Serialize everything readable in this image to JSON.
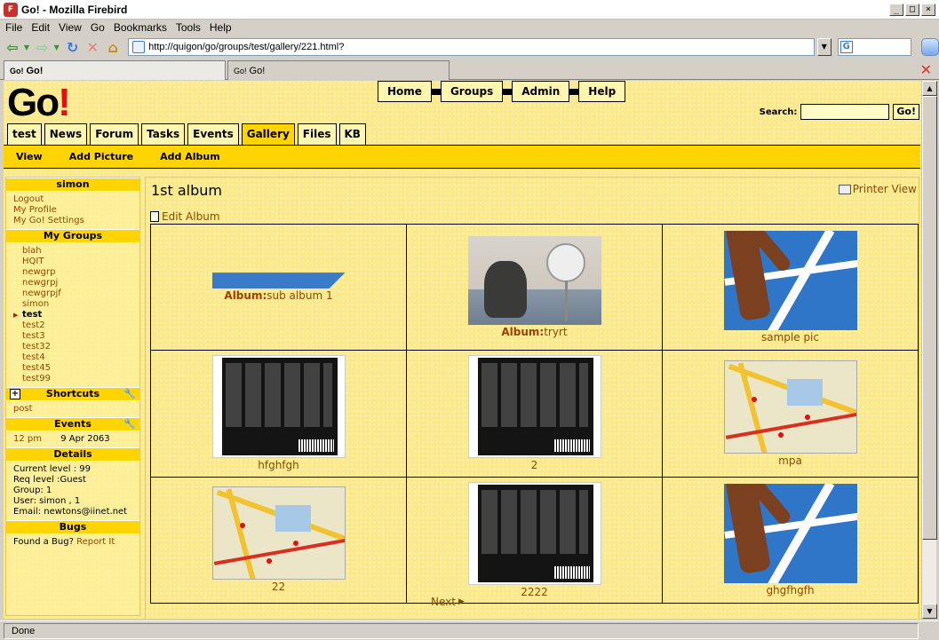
{
  "window": {
    "title": "Go! - Mozilla Firebird",
    "app_icon": "firebird-icon",
    "controls": [
      "minimize",
      "maximize",
      "close"
    ]
  },
  "menu": [
    "File",
    "Edit",
    "View",
    "Go",
    "Bookmarks",
    "Tools",
    "Help"
  ],
  "navigation": {
    "url": "http://quigon/go/groups/test/gallery/221.html?",
    "search_value": "",
    "search_engine_icon": "google-icon"
  },
  "tabs": [
    {
      "favicon": "Go!",
      "label": "Go!",
      "active": true
    },
    {
      "favicon": "Go!",
      "label": "Go!",
      "active": false
    }
  ],
  "status": "Done",
  "site": {
    "logo_text": "Go",
    "logo_bang": "!",
    "top_nav": [
      "Home",
      "Groups",
      "Admin",
      "Help"
    ],
    "search_label": "Search:",
    "search_value": "",
    "search_button": "Go!",
    "main_tabs": [
      {
        "label": "test",
        "active": false
      },
      {
        "label": "News",
        "active": false
      },
      {
        "label": "Forum",
        "active": false
      },
      {
        "label": "Tasks",
        "active": false
      },
      {
        "label": "Events",
        "active": false
      },
      {
        "label": "Gallery",
        "active": true
      },
      {
        "label": "Files",
        "active": false
      },
      {
        "label": "KB",
        "active": false
      }
    ],
    "sub_nav": [
      "View",
      "Add Picture",
      "Add Album"
    ]
  },
  "sidebar": {
    "user_header": "simon",
    "user_links": [
      "Logout",
      "My Profile",
      "My Go! Settings"
    ],
    "groups_header": "My Groups",
    "groups": [
      {
        "name": "blah",
        "current": false
      },
      {
        "name": "HQIT",
        "current": false
      },
      {
        "name": "newgrp",
        "current": false
      },
      {
        "name": "newgrpj",
        "current": false
      },
      {
        "name": "newgrpjf",
        "current": false
      },
      {
        "name": "simon",
        "current": false
      },
      {
        "name": "test",
        "current": true
      },
      {
        "name": "test2",
        "current": false
      },
      {
        "name": "test3",
        "current": false
      },
      {
        "name": "test32",
        "current": false
      },
      {
        "name": "test4",
        "current": false
      },
      {
        "name": "test45",
        "current": false
      },
      {
        "name": "test99",
        "current": false
      }
    ],
    "shortcuts_header": "Shortcuts",
    "shortcuts": [
      "post"
    ],
    "events_header": "Events",
    "event_time": "12 pm",
    "event_date": "9 Apr 2063",
    "details_header": "Details",
    "details": {
      "current_level": "Current level : 99",
      "req_level": "Req level :Guest",
      "group": "Group: 1",
      "user": "User: simon , 1",
      "email": "Email: newtons@iinet.net"
    },
    "bugs_header": "Bugs",
    "bugs_text": "Found a Bug?",
    "bugs_link": "Report It"
  },
  "content": {
    "title": "1st album",
    "printer_view": "Printer View",
    "edit_album": "Edit Album",
    "album_prefix": "Album:",
    "gallery": [
      {
        "type": "album",
        "thumb": "banner",
        "label": "sub album 1"
      },
      {
        "type": "album",
        "thumb": "dog",
        "label": "tryrt"
      },
      {
        "type": "picture",
        "thumb": "track",
        "label": "sample pic"
      },
      {
        "type": "picture",
        "thumb": "sleeve",
        "label": "hfghfgh"
      },
      {
        "type": "picture",
        "thumb": "sleeve",
        "label": "2"
      },
      {
        "type": "picture",
        "thumb": "map",
        "label": "mpa"
      },
      {
        "type": "picture",
        "thumb": "map",
        "label": "22"
      },
      {
        "type": "picture",
        "thumb": "sleeve",
        "label": "2222"
      },
      {
        "type": "picture",
        "thumb": "track",
        "label": "ghgfhgfh"
      }
    ],
    "next_label": "Next"
  }
}
